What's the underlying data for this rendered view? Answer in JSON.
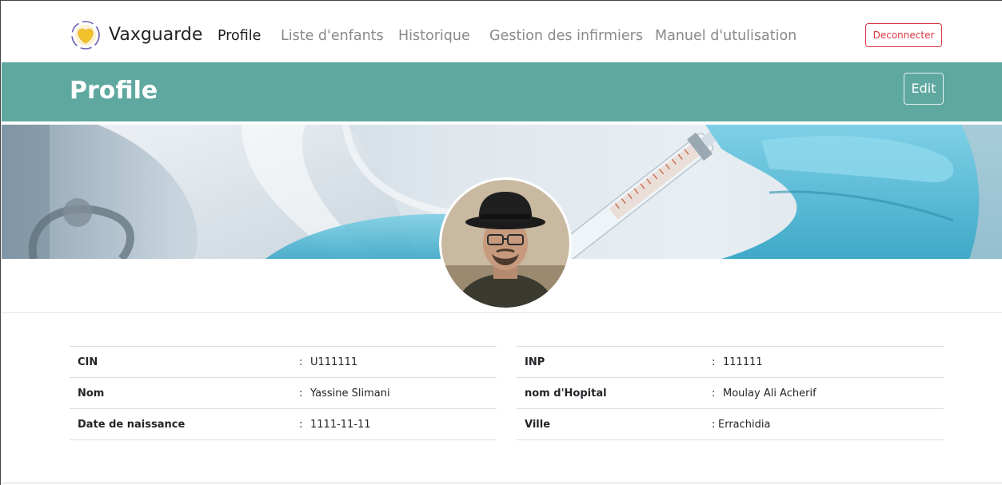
{
  "brand": {
    "name": "Vaxguarde",
    "logo_icon": "heart-logo-icon"
  },
  "nav": {
    "items": [
      {
        "label": "Profile",
        "active": true
      },
      {
        "label": "Liste d'enfants",
        "active": false
      },
      {
        "label": "Historique",
        "active": false
      },
      {
        "label": "Gestion des infirmiers",
        "active": false
      },
      {
        "label": "Manuel d'utulisation",
        "active": false
      }
    ],
    "logout_label": "Deconnecter"
  },
  "header": {
    "title": "Profile",
    "edit_label": "Edit"
  },
  "profile": {
    "left": [
      {
        "label": "CIN",
        "value": "U111111"
      },
      {
        "label": "Nom",
        "value": "Yassine Slimani"
      },
      {
        "label": "Date de naissance",
        "value": "1111-11-11"
      }
    ],
    "right": [
      {
        "label": "INP",
        "value": "111111"
      },
      {
        "label": "nom d'Hopital",
        "value": "Moulay Ali Acherif"
      },
      {
        "label": "Ville",
        "value": "Errachidia"
      }
    ],
    "separator": ":"
  },
  "colors": {
    "accent": "#5fa8a0",
    "danger": "#dc3545",
    "nav_active": "#1c1c1c",
    "nav_inactive": "#8a8a8a"
  }
}
